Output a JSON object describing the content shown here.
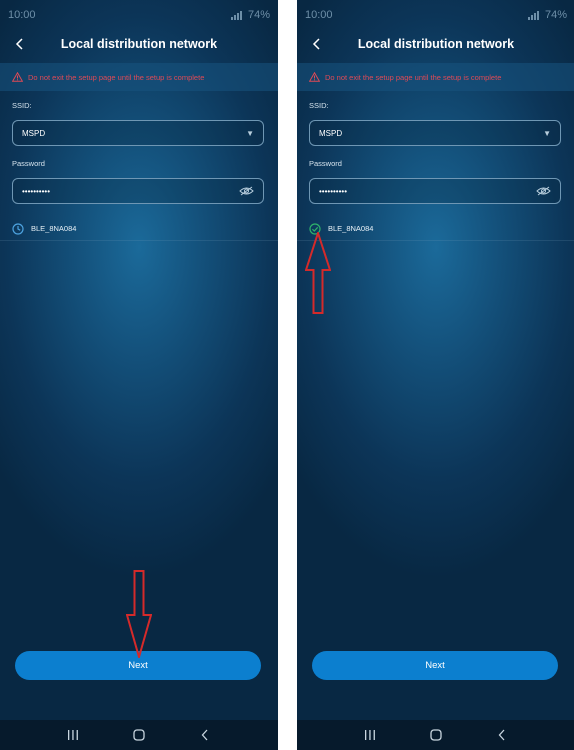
{
  "screens": [
    {
      "status_time": "10:00",
      "status_right": "74%",
      "title": "Local distribution network",
      "warning": "Do not exit the setup page until the setup is complete",
      "ssid_label": "SSID:",
      "ssid_value": "MSPD",
      "password_label": "Password",
      "password_value": "••••••••••",
      "device_name": "BLE_8NA084",
      "device_state": "clock-icon",
      "next_label": "Next"
    },
    {
      "status_time": "10:00",
      "status_right": "74%",
      "title": "Local distribution network",
      "warning": "Do not exit the setup page until the setup is complete",
      "ssid_label": "SSID:",
      "ssid_value": "MSPD",
      "password_label": "Password",
      "password_value": "••••••••••",
      "device_name": "BLE_8NA084",
      "device_state": "check-circle-icon",
      "next_label": "Next"
    }
  ],
  "colors": {
    "warning": "#e04a56",
    "button": "#0c7fcf",
    "annotation_arrow": "#d42a2a",
    "connected": "#2eb36b"
  }
}
